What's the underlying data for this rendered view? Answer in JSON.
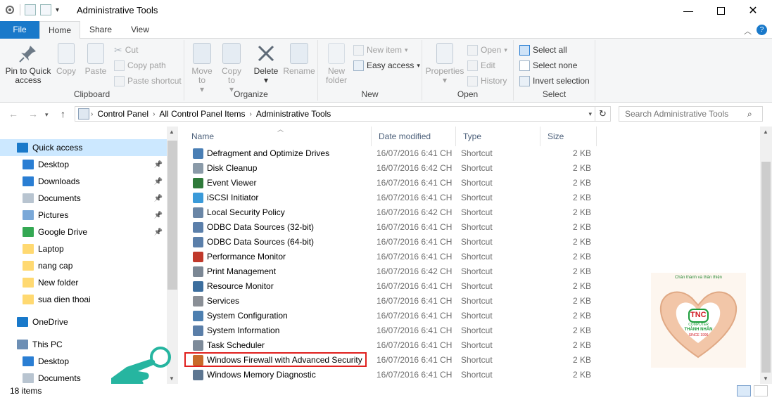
{
  "window": {
    "title": "Administrative Tools"
  },
  "tabs": [
    "File",
    "Home",
    "Share",
    "View"
  ],
  "ribbon": {
    "clipboard": {
      "label": "Clipboard",
      "pin": "Pin to Quick access",
      "copy": "Copy",
      "paste": "Paste",
      "cut": "Cut",
      "copy_path": "Copy path",
      "paste_shortcut": "Paste shortcut"
    },
    "organize": {
      "label": "Organize",
      "move_to": "Move to",
      "copy_to": "Copy to",
      "delete": "Delete",
      "rename": "Rename"
    },
    "new": {
      "label": "New",
      "new_folder": "New folder",
      "new_item": "New item",
      "easy_access": "Easy access"
    },
    "open": {
      "label": "Open",
      "properties": "Properties",
      "open": "Open",
      "edit": "Edit",
      "history": "History"
    },
    "select": {
      "label": "Select",
      "select_all": "Select all",
      "select_none": "Select none",
      "invert_selection": "Invert selection"
    }
  },
  "address": {
    "crumbs": [
      "Control Panel",
      "All Control Panel Items",
      "Administrative Tools"
    ]
  },
  "search": {
    "placeholder": "Search Administrative Tools"
  },
  "nav": {
    "items": [
      {
        "label": "Quick access",
        "icon": "star-icon",
        "color": "#1979ca",
        "pinned": false
      },
      {
        "label": "Desktop",
        "icon": "desktop-icon",
        "color": "#2a7ed3",
        "pinned": true
      },
      {
        "label": "Downloads",
        "icon": "download-icon",
        "color": "#2a7ed3",
        "pinned": true
      },
      {
        "label": "Documents",
        "icon": "document-icon",
        "color": "#b8c4d0",
        "pinned": true
      },
      {
        "label": "Pictures",
        "icon": "picture-icon",
        "color": "#7aa8d8",
        "pinned": true
      },
      {
        "label": "Google Drive",
        "icon": "google-drive-icon",
        "color": "#34a853",
        "pinned": true
      },
      {
        "label": "Laptop",
        "icon": "folder-icon",
        "color": "#ffd971",
        "pinned": false
      },
      {
        "label": "nang cap",
        "icon": "folder-icon",
        "color": "#ffd971",
        "pinned": false
      },
      {
        "label": "New folder",
        "icon": "folder-icon",
        "color": "#ffd971",
        "pinned": false
      },
      {
        "label": "sua dien thoai",
        "icon": "folder-icon",
        "color": "#ffd971",
        "pinned": false
      },
      {
        "label": "OneDrive",
        "icon": "cloud-icon",
        "color": "#1979ca",
        "pinned": false
      },
      {
        "label": "This PC",
        "icon": "computer-icon",
        "color": "#6d8fb5",
        "pinned": false
      },
      {
        "label": "Desktop",
        "icon": "desktop-icon",
        "color": "#2a7ed3",
        "pinned": false
      },
      {
        "label": "Documents",
        "icon": "document-icon",
        "color": "#b8c4d0",
        "pinned": false
      }
    ]
  },
  "columns": {
    "name": "Name",
    "date": "Date modified",
    "type": "Type",
    "size": "Size"
  },
  "files": [
    {
      "name": "Defragment and Optimize Drives",
      "date": "16/07/2016 6:41 CH",
      "type": "Shortcut",
      "size": "2 KB",
      "icon": "defrag-icon",
      "color": "#4a7fb5"
    },
    {
      "name": "Disk Cleanup",
      "date": "16/07/2016 6:42 CH",
      "type": "Shortcut",
      "size": "2 KB",
      "icon": "disk-cleanup-icon",
      "color": "#8a9aa8"
    },
    {
      "name": "Event Viewer",
      "date": "16/07/2016 6:41 CH",
      "type": "Shortcut",
      "size": "2 KB",
      "icon": "event-viewer-icon",
      "color": "#2f7a3a"
    },
    {
      "name": "iSCSI Initiator",
      "date": "16/07/2016 6:41 CH",
      "type": "Shortcut",
      "size": "2 KB",
      "icon": "globe-icon",
      "color": "#3a9ad9"
    },
    {
      "name": "Local Security Policy",
      "date": "16/07/2016 6:42 CH",
      "type": "Shortcut",
      "size": "2 KB",
      "icon": "security-policy-icon",
      "color": "#6a86a6"
    },
    {
      "name": "ODBC Data Sources (32-bit)",
      "date": "16/07/2016 6:41 CH",
      "type": "Shortcut",
      "size": "2 KB",
      "icon": "database-icon",
      "color": "#5b7faa"
    },
    {
      "name": "ODBC Data Sources (64-bit)",
      "date": "16/07/2016 6:41 CH",
      "type": "Shortcut",
      "size": "2 KB",
      "icon": "database-icon",
      "color": "#5b7faa"
    },
    {
      "name": "Performance Monitor",
      "date": "16/07/2016 6:41 CH",
      "type": "Shortcut",
      "size": "2 KB",
      "icon": "performance-icon",
      "color": "#c0392b"
    },
    {
      "name": "Print Management",
      "date": "16/07/2016 6:42 CH",
      "type": "Shortcut",
      "size": "2 KB",
      "icon": "printer-icon",
      "color": "#7b8794"
    },
    {
      "name": "Resource Monitor",
      "date": "16/07/2016 6:41 CH",
      "type": "Shortcut",
      "size": "2 KB",
      "icon": "resource-monitor-icon",
      "color": "#3c6e9e"
    },
    {
      "name": "Services",
      "date": "16/07/2016 6:41 CH",
      "type": "Shortcut",
      "size": "2 KB",
      "icon": "gear-icon",
      "color": "#8a8f96"
    },
    {
      "name": "System Configuration",
      "date": "16/07/2016 6:41 CH",
      "type": "Shortcut",
      "size": "2 KB",
      "icon": "system-config-icon",
      "color": "#4d7fb0"
    },
    {
      "name": "System Information",
      "date": "16/07/2016 6:41 CH",
      "type": "Shortcut",
      "size": "2 KB",
      "icon": "system-info-icon",
      "color": "#5a7ea8"
    },
    {
      "name": "Task Scheduler",
      "date": "16/07/2016 6:41 CH",
      "type": "Shortcut",
      "size": "2 KB",
      "icon": "clock-icon",
      "color": "#7d8a99"
    },
    {
      "name": "Windows Firewall with Advanced Security",
      "date": "16/07/2016 6:41 CH",
      "type": "Shortcut",
      "size": "2 KB",
      "icon": "firewall-icon",
      "color": "#c86a2a"
    },
    {
      "name": "Windows Memory Diagnostic",
      "date": "16/07/2016 6:41 CH",
      "type": "Shortcut",
      "size": "2 KB",
      "icon": "memory-icon",
      "color": "#5d7691"
    }
  ],
  "status": {
    "count": "18 items"
  },
  "overlay": {
    "logo_tagline": "Chân thành và thân thiện",
    "logo_brand": "TNC",
    "logo_sub": "COMPUTER",
    "logo_name": "THÀNH NHÂN",
    "logo_since": "SINCE 1996"
  }
}
